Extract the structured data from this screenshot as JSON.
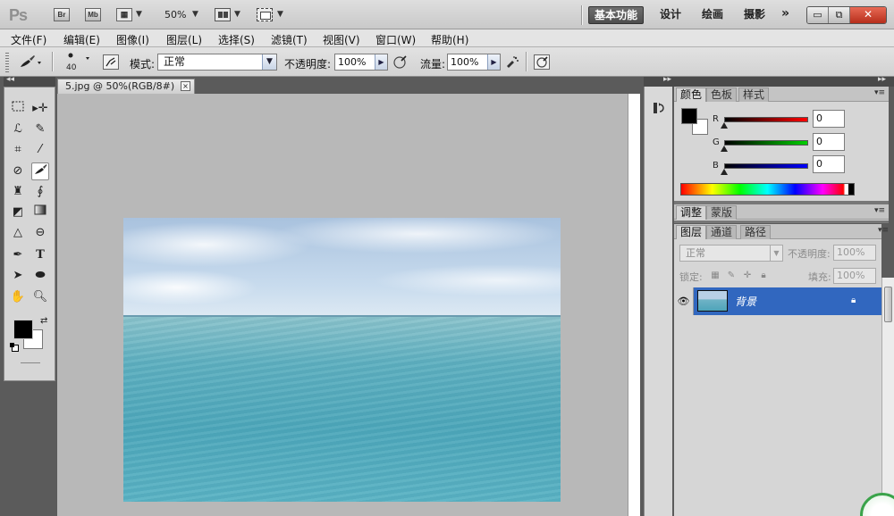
{
  "titlebar": {
    "logo": "Ps",
    "bridge": "Br",
    "minibridge": "Mb",
    "zoom": "50%",
    "workspaces": [
      "基本功能",
      "设计",
      "绘画",
      "摄影"
    ],
    "more": "»",
    "window_min": "▭",
    "window_max": "⧉",
    "window_close": "✕"
  },
  "menu": [
    "文件(F)",
    "编辑(E)",
    "图像(I)",
    "图层(L)",
    "选择(S)",
    "滤镜(T)",
    "视图(V)",
    "窗口(W)",
    "帮助(H)"
  ],
  "options": {
    "brush_size": "40",
    "mode_label": "模式:",
    "mode_value": "正常",
    "opacity_label": "不透明度:",
    "opacity_value": "100%",
    "flow_label": "流量:",
    "flow_value": "100%"
  },
  "document": {
    "tab_title": "5.jpg @ 50%(RGB/8#)",
    "tab_close": "×"
  },
  "color_panel": {
    "tabs": [
      "颜色",
      "色板",
      "样式"
    ],
    "channels": [
      {
        "label": "R",
        "value": "0"
      },
      {
        "label": "G",
        "value": "0"
      },
      {
        "label": "B",
        "value": "0"
      }
    ]
  },
  "adjust_panel": {
    "tabs": [
      "调整",
      "蒙版"
    ]
  },
  "layers_panel": {
    "tabs": [
      "图层",
      "通道",
      "路径"
    ],
    "blend_mode": "正常",
    "opacity_label": "不透明度:",
    "opacity_value": "100%",
    "lock_label": "锁定:",
    "fill_label": "填充:",
    "fill_value": "100%",
    "layers": [
      {
        "name": "背景"
      }
    ]
  },
  "colors": {
    "layer_selected": "#3167bf",
    "workspace_active": "#5a5a5a",
    "close_button": "#c8402b"
  }
}
